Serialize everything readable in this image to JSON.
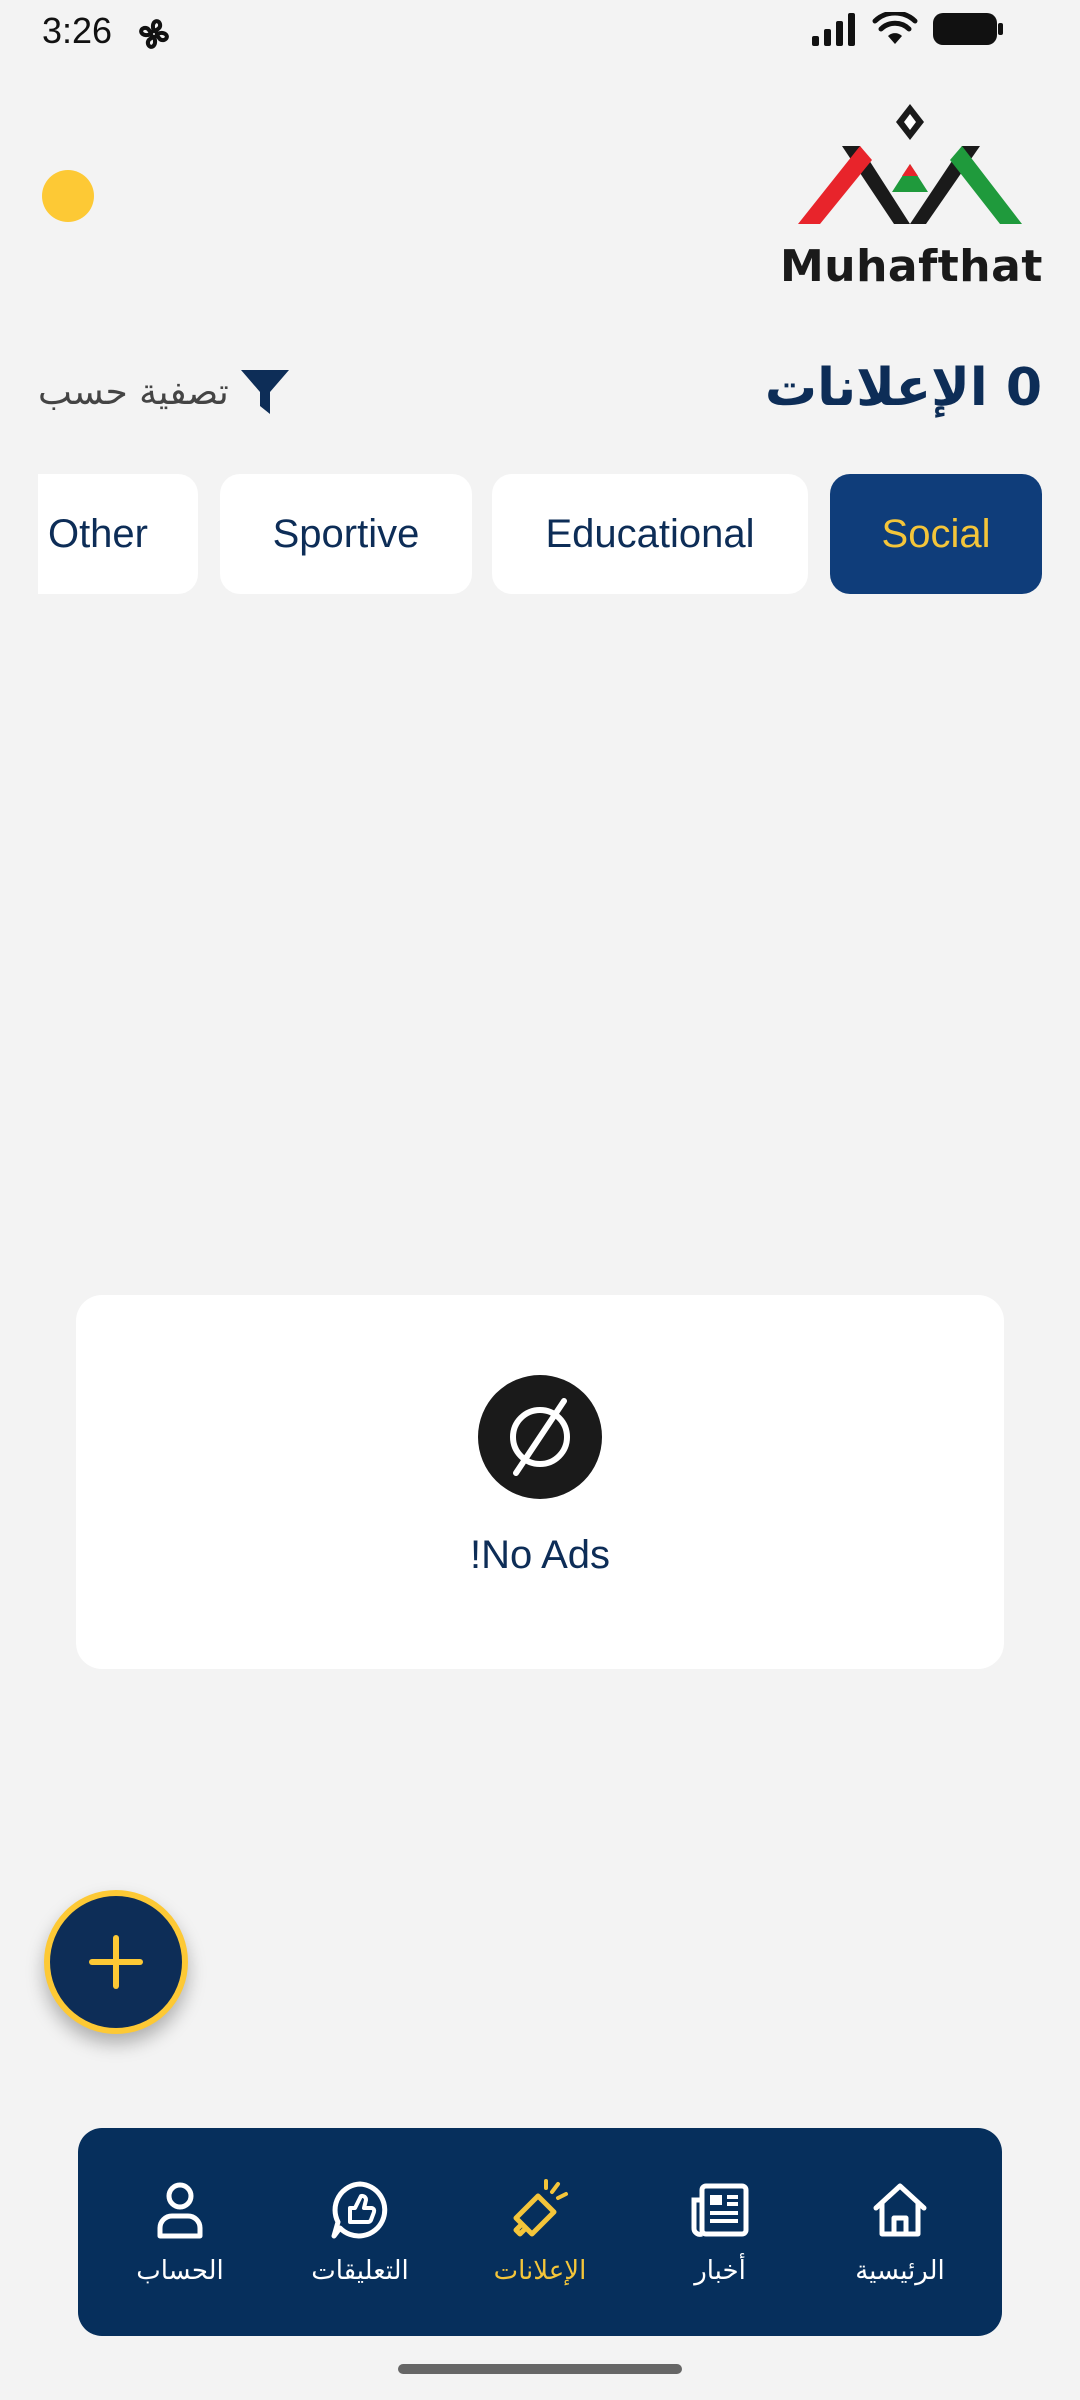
{
  "status_bar": {
    "time": "3:26"
  },
  "logo": {
    "text": "Muhafthat"
  },
  "header": {
    "ads_count_title": "0 الإعلانات",
    "filter_label": "تصفية حسب"
  },
  "categories": [
    {
      "label": "Social",
      "active": true
    },
    {
      "label": "Educational",
      "active": false
    },
    {
      "label": "Sportive",
      "active": false
    },
    {
      "label": "Other",
      "active": false
    }
  ],
  "empty_state": {
    "message": "!No Ads"
  },
  "bottom_nav": [
    {
      "label": "الرئيسية",
      "icon": "home-icon",
      "active": false
    },
    {
      "label": "أخبار",
      "icon": "news-icon",
      "active": false
    },
    {
      "label": "الإعلانات",
      "icon": "megaphone-icon",
      "active": true
    },
    {
      "label": "التعليقات",
      "icon": "thumbs-up-chat-icon",
      "active": false
    },
    {
      "label": "الحساب",
      "icon": "user-icon",
      "active": false
    }
  ],
  "colors": {
    "primary": "#0d2d57",
    "accent": "#f4c53a",
    "nav_bg": "#062f5c",
    "background": "#f3f3f3"
  }
}
